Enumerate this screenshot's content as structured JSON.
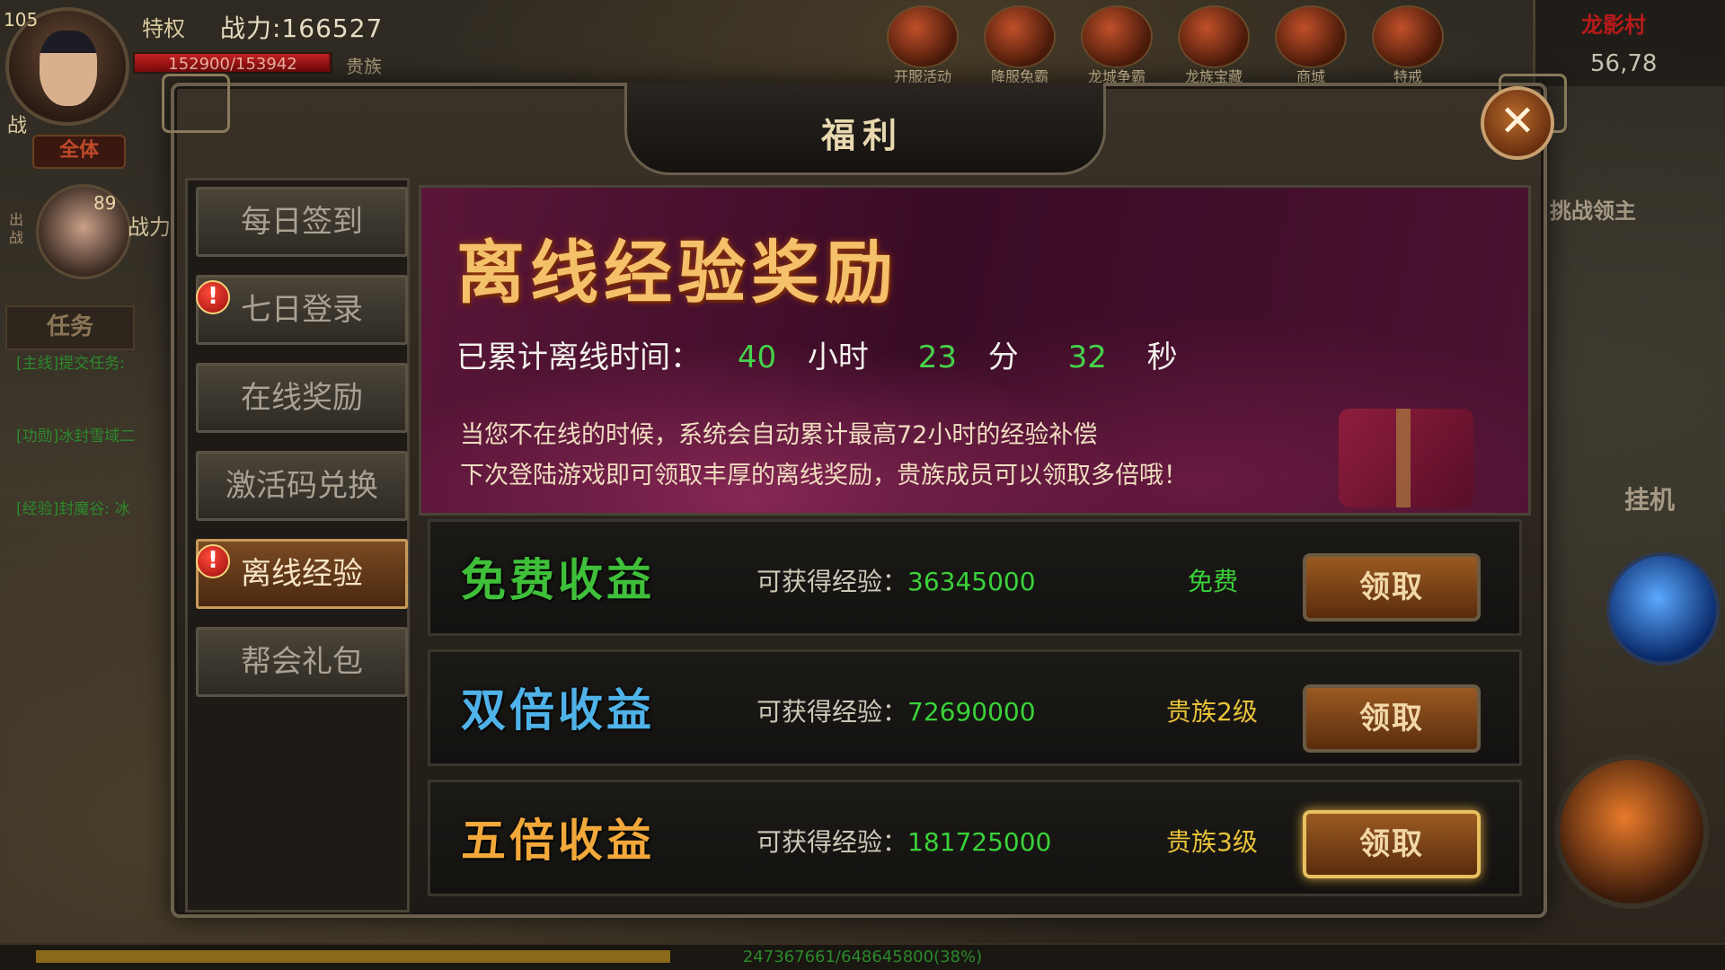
{
  "hud": {
    "player_level": "105",
    "vip_label": "特权",
    "power_text": "战力:166527",
    "hp_text": "152900/153942",
    "hp_fraction": 0.993,
    "noble_label": "贵族",
    "battle_tag": "战",
    "mode_label": "全体",
    "pet_level": "89",
    "pet_out_label": "出战",
    "pet_power_label": "战力",
    "task_tab": "任务",
    "task_items": [
      "[主线]提交任务:",
      "[功勋]冰封雪域二",
      "[经验]封魔谷: 冰"
    ]
  },
  "top_icons": [
    "开服活动",
    "降服兔霸",
    "龙城争霸",
    "龙族宝藏",
    "商城",
    "特戒"
  ],
  "minimap": {
    "name": "龙影村",
    "coords": "56,78"
  },
  "right_labels": {
    "boss": "挑战领主",
    "auto": "挂机"
  },
  "exp_bar": {
    "text": "247367661/648645800(38%)",
    "fraction": 0.38
  },
  "dialog": {
    "title": "福利",
    "close_glyph": "✕",
    "alert_glyph": "!",
    "sidebar": [
      {
        "label": "每日签到",
        "alert": false,
        "active": false
      },
      {
        "label": "七日登录",
        "alert": true,
        "active": false
      },
      {
        "label": "在线奖励",
        "alert": false,
        "active": false
      },
      {
        "label": "激活码兑换",
        "alert": false,
        "active": false
      },
      {
        "label": "离线经验",
        "alert": true,
        "active": true
      },
      {
        "label": "帮会礼包",
        "alert": false,
        "active": false
      }
    ],
    "banner": {
      "title": "离线经验奖励",
      "accum_label": "已累计离线时间：",
      "hours": "40",
      "hours_unit": "小时",
      "minutes": "23",
      "minutes_unit": "分",
      "seconds": "32",
      "seconds_unit": "秒",
      "desc1": "当您不在线的时候，系统会自动累计最高72小时的经验补偿",
      "desc2": "下次登陆游戏即可领取丰厚的离线奖励，贵族成员可以领取多倍哦！"
    },
    "rewards": [
      {
        "name": "免费收益",
        "exp_label": "可获得经验：",
        "exp_value": "36345000",
        "requirement": "免费",
        "button": "领取",
        "name_color": "#3fbf3a",
        "req_color": "#3ad23a"
      },
      {
        "name": "双倍收益",
        "exp_label": "可获得经验：",
        "exp_value": "72690000",
        "requirement": "贵族2级",
        "button": "领取",
        "name_color": "#4fb2e8",
        "req_color": "#e8c23a"
      },
      {
        "name": "五倍收益",
        "exp_label": "可获得经验：",
        "exp_value": "181725000",
        "requirement": "贵族3级",
        "button": "领取",
        "name_color": "#f2a83a",
        "req_color": "#e8c23a"
      }
    ]
  }
}
